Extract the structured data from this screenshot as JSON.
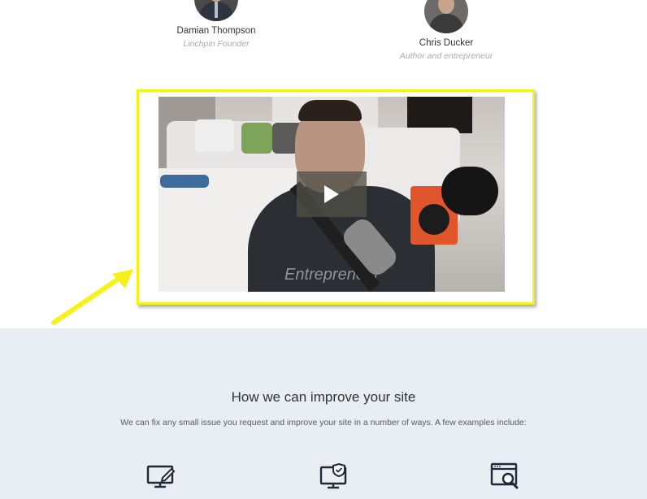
{
  "team": [
    {
      "name": "Damian Thompson",
      "role": "Linchpin Founder",
      "avatar_icon": "person-photo"
    },
    {
      "name": "Chris Ducker",
      "role": "Author and entrepreneur",
      "avatar_icon": "person-photo"
    }
  ],
  "video": {
    "play_icon": "play-icon",
    "frame_highlight_color": "#f5f21b",
    "overlay_text": "Entrepreneur"
  },
  "annotations": {
    "arrow_color": "#f5f21b"
  },
  "improve": {
    "title": "How we can improve your site",
    "description": "We can fix any small issue you request and improve your site in a number of ways. A few examples include:",
    "icons": [
      "monitor-edit-icon",
      "monitor-shield-icon",
      "browser-search-icon"
    ],
    "background_color": "#e9eef5"
  }
}
